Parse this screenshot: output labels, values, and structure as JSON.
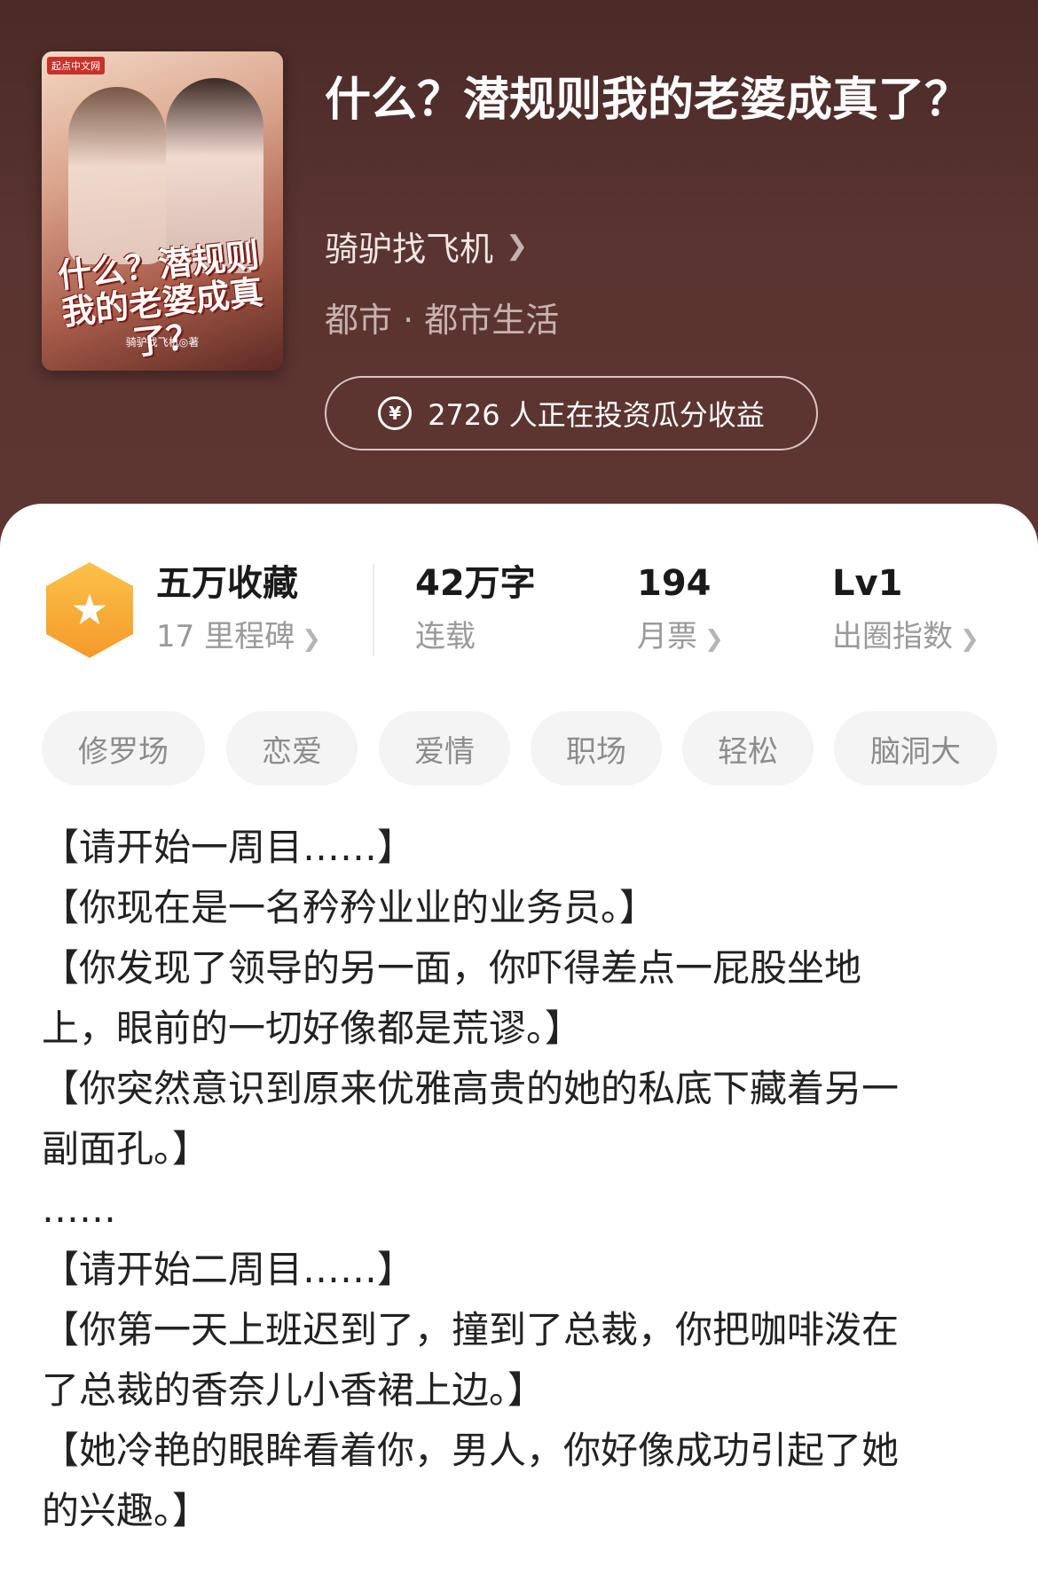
{
  "book": {
    "title": "什么？潜规则我的老婆成真了？",
    "author": "骑驴找飞机",
    "genre": "都市 · 都市生活",
    "invest_text": "2726 人正在投资瓜分收益",
    "cover": {
      "title_text": "什么？潜规则我的老婆成真了？",
      "badge": "起点中文网",
      "author_text": "骑驴找飞机◎著"
    }
  },
  "stats": {
    "collect_label": "五万收藏",
    "milestone_label": "17 里程碑",
    "words_value": "42万字",
    "words_status": "连载",
    "ticket_value": "194",
    "ticket_label": "月票",
    "level_value": "Lv1",
    "level_label": "出圈指数"
  },
  "tags": [
    "修罗场",
    "恋爱",
    "爱情",
    "职场",
    "轻松",
    "脑洞大"
  ],
  "synopsis": [
    "【请开始一周目……】",
    "【你现在是一名矜矜业业的业务员。】",
    "【你发现了领导的另一面，你吓得差点一屁股坐地",
    "上，眼前的一切好像都是荒谬。】",
    "【你突然意识到原来优雅高贵的她的私底下藏着另一",
    "副面孔。】",
    "……",
    "【请开始二周目……】",
    "【你第一天上班迟到了，撞到了总裁，你把咖啡泼在",
    "了总裁的香奈儿小香裙上边。】",
    "【她冷艳的眼眸看着你，男人，你好像成功引起了她",
    "的兴趣。】"
  ],
  "colors": {
    "header_bg": "#5a3430",
    "hex_badge": "#f7a833",
    "tag_bg": "#f4f4f4"
  },
  "icons": {
    "yen": "yen-circle-icon",
    "star": "star-icon",
    "chevron": "chevron-right-icon"
  }
}
